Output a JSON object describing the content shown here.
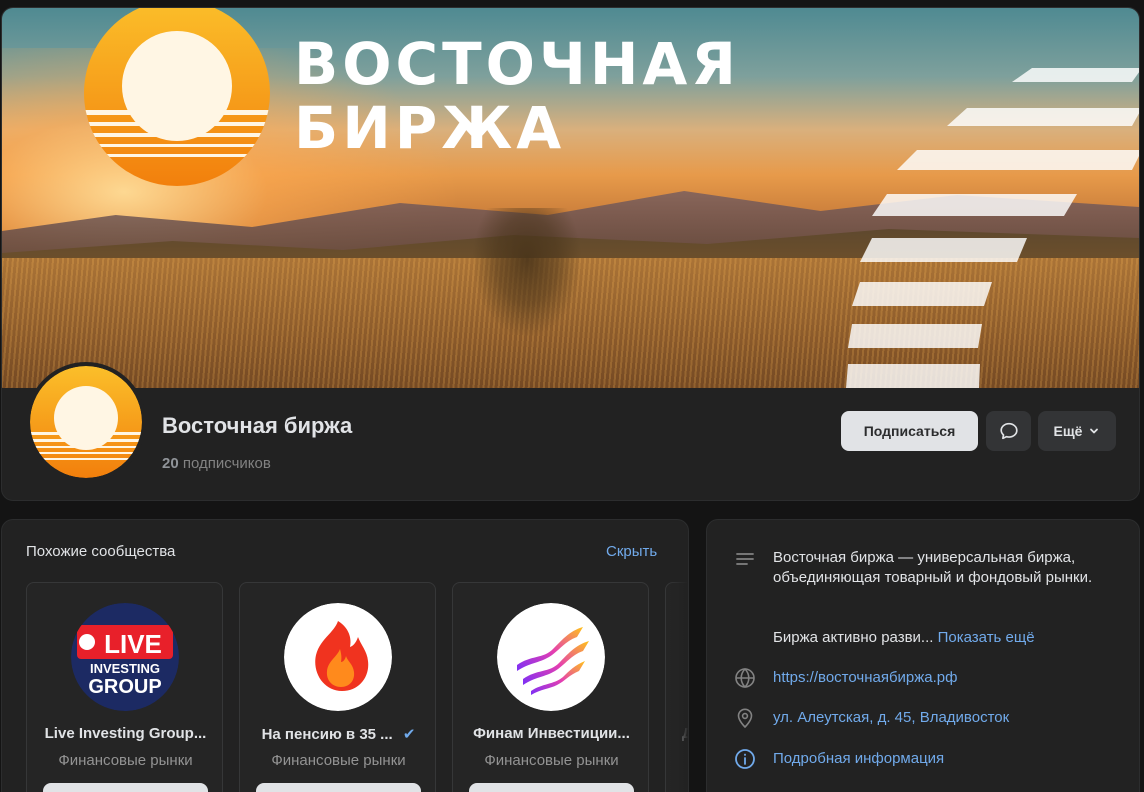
{
  "cover": {
    "brand_line1": "ВОСТОЧНАЯ",
    "brand_line2": "БИРЖА",
    "accent_orange": "#f7a21b"
  },
  "profile": {
    "name": "Восточная биржа",
    "subscribers_count": "20",
    "subscribers_label": "подписчиков"
  },
  "actions": {
    "subscribe_label": "Подписаться",
    "message_icon": "chat-bubble-icon",
    "more_label": "Ещё",
    "more_icon": "chevron-down-icon"
  },
  "similar": {
    "title": "Похожие сообщества",
    "hide_label": "Скрыть",
    "items": [
      {
        "name": "Live Investing Group...",
        "category": "Финансовые рынки",
        "avatar_text": [
          "LIVE",
          "INVESTING",
          "GROUP"
        ],
        "verified": false
      },
      {
        "name": "На пенсию в 35 ...",
        "category": "Финансовые рынки",
        "verified": true
      },
      {
        "name": "Финам Инвестиции...",
        "category": "Финансовые рынки",
        "verified": false
      },
      {
        "name": "Д",
        "category": "",
        "verified": false
      }
    ]
  },
  "about": {
    "description": "Восточная биржа — универсальная биржа, объединяющая товарный и фондовый рынки.",
    "more_text": "Биржа активно разви...",
    "show_more_label": "Показать ещё",
    "website": "https://восточнаябиржа.рф",
    "address": "ул. Алеутская, д. 45, Владивосток",
    "details_label": "Подробная информация",
    "link_color": "#71aaeb"
  }
}
